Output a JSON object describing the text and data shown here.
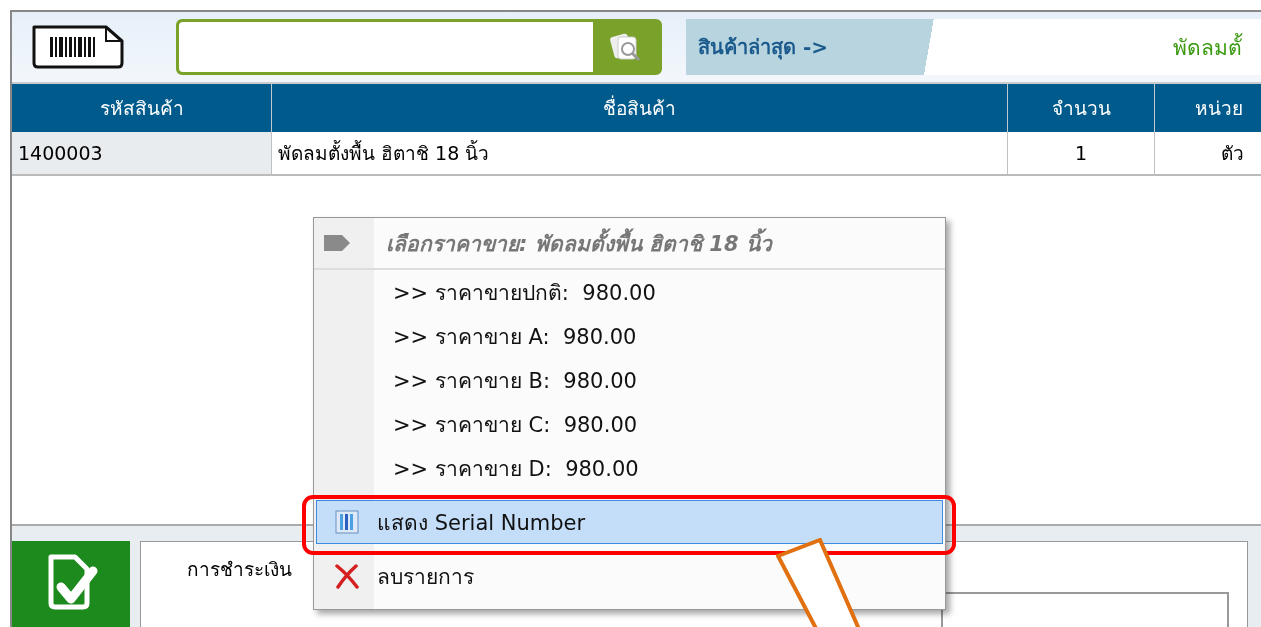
{
  "toolbar": {
    "latest_label": "สินค้าล่าสุด ->",
    "latest_product": "พัดลมตั้"
  },
  "table": {
    "columns": [
      "รหัสสินค้า",
      "ชื่อสินค้า",
      "จำนวน",
      "หน่วย"
    ],
    "rows": [
      {
        "cells": [
          "1400003",
          "พัดลมตั้งพื้น ฮิตาชิ 18 นิ้ว",
          "1",
          "ตัว"
        ]
      }
    ]
  },
  "payment": {
    "tab": "การชำระเงิน"
  },
  "context_menu": {
    "title": "เลือกราคาขาย: พัดลมตั้งพื้น ฮิตาชิ 18 นิ้ว",
    "items": [
      {
        "kind": "price",
        "label": ">> ราคาขายปกติ:  980.00",
        "selected": false
      },
      {
        "kind": "price",
        "label": ">> ราคาขาย A:  980.00",
        "selected": false
      },
      {
        "kind": "price",
        "label": ">> ราคาขาย B:  980.00",
        "selected": false
      },
      {
        "kind": "price",
        "label": ">> ราคาขาย C:  980.00",
        "selected": false
      },
      {
        "kind": "price",
        "label": ">> ราคาขาย D:  980.00",
        "selected": false
      },
      {
        "kind": "serial",
        "label": "แสดง Serial Number",
        "selected": true
      },
      {
        "kind": "delete",
        "label": "ลบรายการ",
        "selected": false
      }
    ]
  }
}
